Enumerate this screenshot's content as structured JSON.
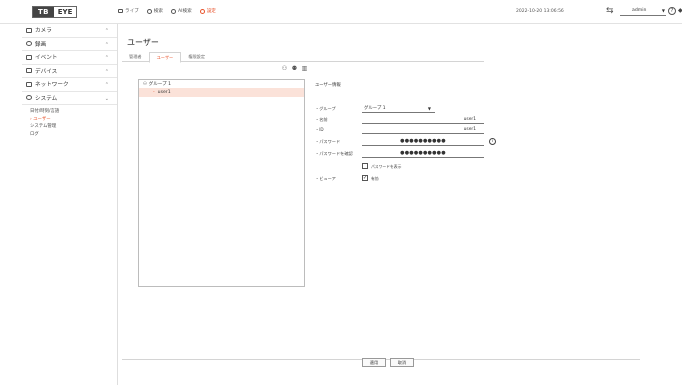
{
  "header": {
    "logo_left": "TB",
    "logo_right": "EYE",
    "menu": [
      {
        "label": "ライブ",
        "icon": "monitor-icon"
      },
      {
        "label": "検索",
        "icon": "search-icon"
      },
      {
        "label": "AI検索",
        "icon": "ai-search-icon"
      },
      {
        "label": "設定",
        "icon": "gear-icon"
      }
    ],
    "datetime": "2022-10-20 13:06:56",
    "user": "admin"
  },
  "sidebar": {
    "items": [
      {
        "label": "カメラ",
        "icon": "camera-icon"
      },
      {
        "label": "録画",
        "icon": "record-icon"
      },
      {
        "label": "イベント",
        "icon": "event-icon"
      },
      {
        "label": "デバイス",
        "icon": "device-icon"
      },
      {
        "label": "ネットワーク",
        "icon": "network-icon"
      },
      {
        "label": "システム",
        "icon": "system-icon"
      }
    ],
    "subitems": [
      "日付/時刻/言語",
      "ユーザー",
      "システム管理",
      "ログ"
    ]
  },
  "main": {
    "title": "ユーザー",
    "tabs": [
      "管理者",
      "ユーザー",
      "権限設定"
    ],
    "tree": {
      "group": "グループ 1",
      "user": "user1"
    },
    "form": {
      "header": "ユーザー情報",
      "group_label": "・グループ",
      "group_value": "グループ 1",
      "name_label": "・名前",
      "name_value": "user1",
      "id_label": "・ID",
      "id_value": "user1",
      "password_label": "・パスワード",
      "password_value": "●●●●●●●●●●",
      "confirm_label": "・パスワードを確認",
      "confirm_value": "●●●●●●●●●●",
      "show_password_label": "パスワードを表示",
      "viewer_label": "・ビューア",
      "viewer_option": "有効"
    },
    "buttons": {
      "apply": "適用",
      "cancel": "取消"
    }
  }
}
